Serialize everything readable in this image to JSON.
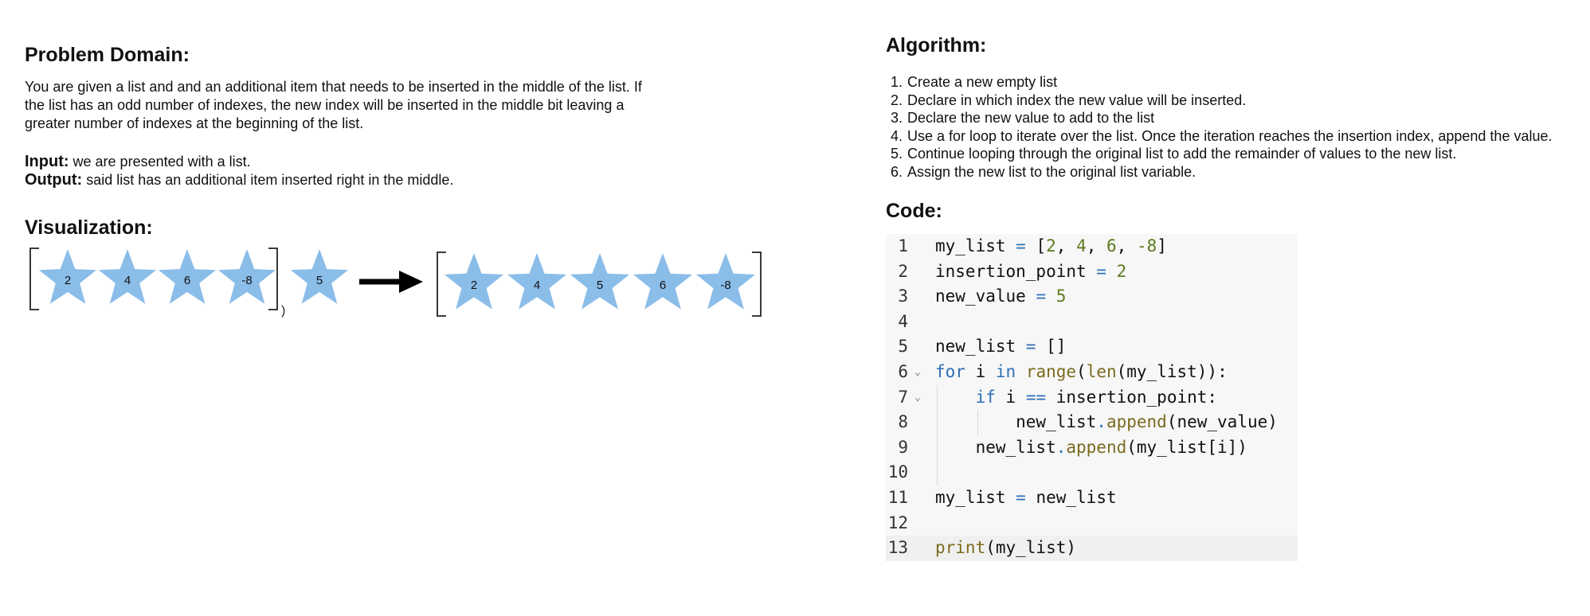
{
  "problem": {
    "heading": "Problem Domain:",
    "description": "You are given a list and and an additional item that needs to be inserted in the middle of the list. If the list has an odd number of indexes, the new index will be inserted in the middle bit leaving a greater number of indexes at the beginning of the list.",
    "input_label": "Input:",
    "input_text": " we are presented with a list.",
    "output_label": "Output:",
    "output_text": " said list has an additional item inserted right in the middle."
  },
  "visualization": {
    "heading": "Visualization:",
    "star_color": "#8bbde9",
    "before_list": [
      "2",
      "4",
      "6",
      "-8"
    ],
    "before_bracket_mark": ")",
    "new_item": "5",
    "after_list": [
      "2",
      "4",
      "5",
      "6",
      "-8"
    ]
  },
  "algorithm": {
    "heading": "Algorithm:",
    "steps": [
      "Create a new empty list",
      "Declare in which index the new value will be inserted.",
      "Declare the new value to add to the list",
      "Use a for loop to iterate over the list. Once the iteration reaches the insertion index, append the value.",
      "Continue looping through the original list to add the remainder of values to the new list.",
      "Assign the new list to the original list variable."
    ]
  },
  "code": {
    "heading": "Code:",
    "active_line": 13,
    "lines": [
      {
        "num": "1",
        "text": "my_list = [2, 4, 6, -8]"
      },
      {
        "num": "2",
        "text": "insertion_point = 2"
      },
      {
        "num": "3",
        "text": "new_value = 5"
      },
      {
        "num": "4",
        "text": ""
      },
      {
        "num": "5",
        "text": "new_list = []"
      },
      {
        "num": "6",
        "text": "for i in range(len(my_list)):",
        "fold": true
      },
      {
        "num": "7",
        "text": "    if i == insertion_point:",
        "fold": true
      },
      {
        "num": "8",
        "text": "        new_list.append(new_value)"
      },
      {
        "num": "9",
        "text": "    new_list.append(my_list[i])"
      },
      {
        "num": "10",
        "text": ""
      },
      {
        "num": "11",
        "text": "my_list = new_list"
      },
      {
        "num": "12",
        "text": ""
      },
      {
        "num": "13",
        "text": "print(my_list)"
      }
    ]
  }
}
